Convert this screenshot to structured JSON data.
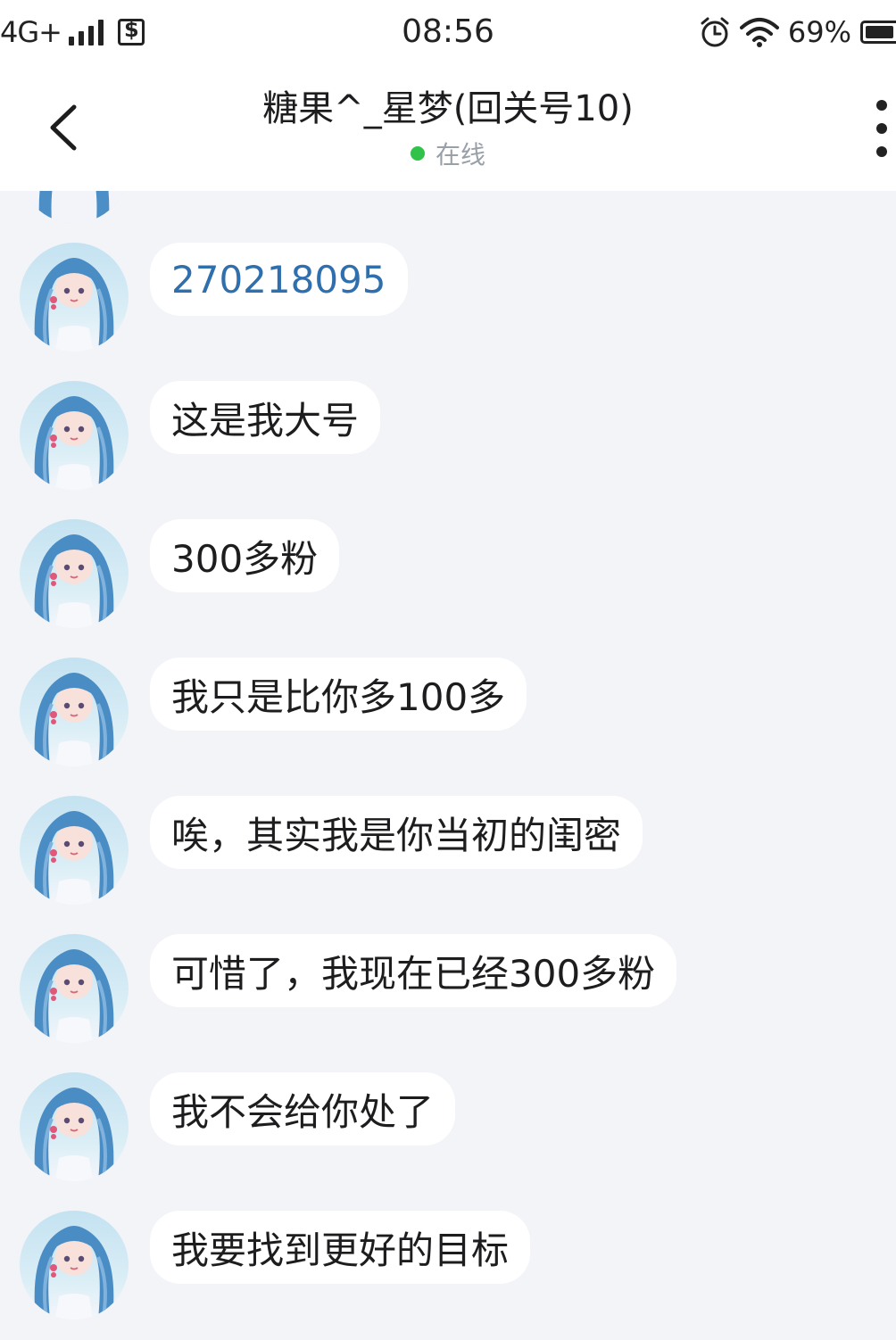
{
  "status_bar": {
    "network": "4G+",
    "time": "08:56",
    "battery": "69%",
    "icons": [
      "signal-icon",
      "data-saver-icon",
      "alarm-icon",
      "wifi-icon",
      "battery-icon"
    ]
  },
  "header": {
    "title": "糖果^_星梦(回关号10)",
    "status": "在线",
    "status_color": "#31c24a"
  },
  "messages": [
    {
      "text": "270218095",
      "type": "link",
      "color": "#2f6fad"
    },
    {
      "text": "这是我大号",
      "type": "text"
    },
    {
      "text": "300多粉",
      "type": "text"
    },
    {
      "text": "我只是比你多100多",
      "type": "text"
    },
    {
      "text": "唉，其实我是你当初的闺密",
      "type": "text"
    },
    {
      "text": "可惜了，我现在已经300多粉",
      "type": "text"
    },
    {
      "text": "我不会给你处了",
      "type": "text"
    },
    {
      "text": "我要找到更好的目标",
      "type": "text"
    }
  ]
}
